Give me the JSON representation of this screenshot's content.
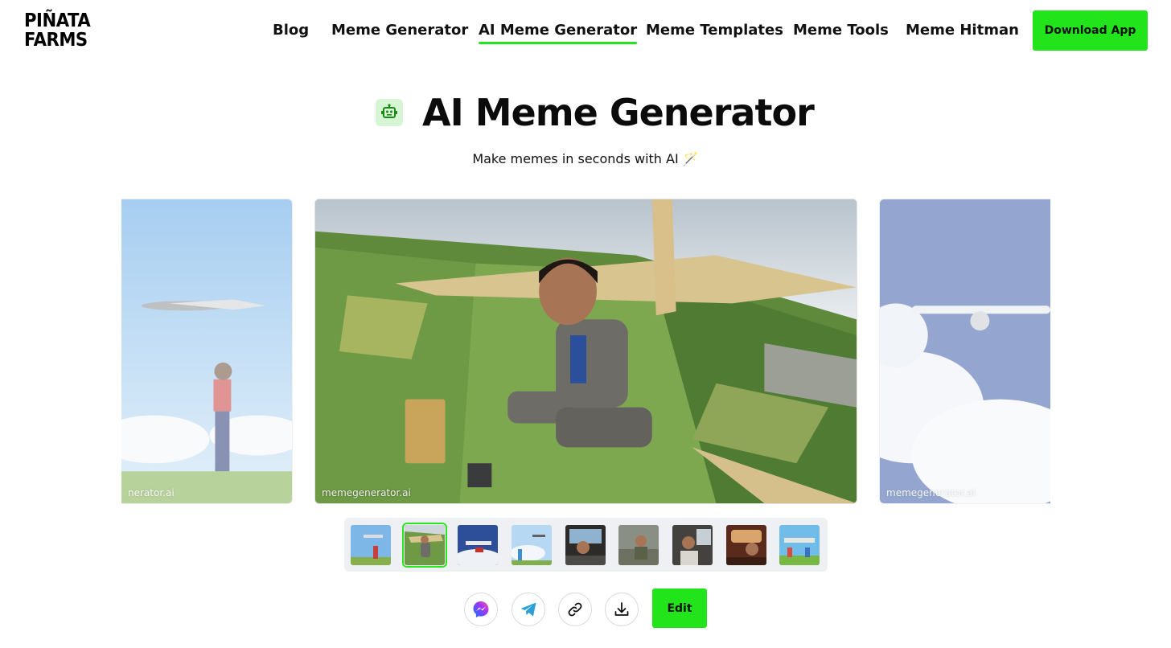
{
  "brand": {
    "logo_line1": "PIÑATA",
    "logo_line2": "FARMS"
  },
  "nav": {
    "items": [
      {
        "label": "Blog"
      },
      {
        "label": "Meme Generator"
      },
      {
        "label": "AI Meme Generator",
        "active": true
      },
      {
        "label": "Meme Templates"
      },
      {
        "label": "Meme Tools"
      },
      {
        "label": "Meme Hitman"
      }
    ],
    "cta_label": "Download App"
  },
  "hero": {
    "icon": "robot-icon",
    "title": "AI Meme Generator",
    "subtitle": "Make memes in seconds with AI 🪄"
  },
  "carousel": {
    "slides": [
      {
        "scene": "boy-with-airplane",
        "watermark": "nerator.ai"
      },
      {
        "scene": "glider-pilot",
        "watermark": "memegenerator.ai"
      },
      {
        "scene": "airliner-over-clouds",
        "watermark": "memegenerator.ai"
      }
    ],
    "thumbnails": [
      {
        "scene": "boy-with-airplane"
      },
      {
        "scene": "glider-pilot",
        "active": true
      },
      {
        "scene": "superhero-over-plane"
      },
      {
        "scene": "girl-with-plane"
      },
      {
        "scene": "cockpit-selfie"
      },
      {
        "scene": "soldier"
      },
      {
        "scene": "cockpit-pilot"
      },
      {
        "scene": "car-selfie"
      },
      {
        "scene": "cartoon-plane"
      }
    ]
  },
  "actions": {
    "share_icons": [
      "messenger-icon",
      "telegram-icon",
      "link-icon",
      "download-icon"
    ],
    "edit_label": "Edit"
  },
  "colors": {
    "accent": "#21e41b",
    "accent_soft": "#d6f5d4",
    "text": "#111111"
  }
}
